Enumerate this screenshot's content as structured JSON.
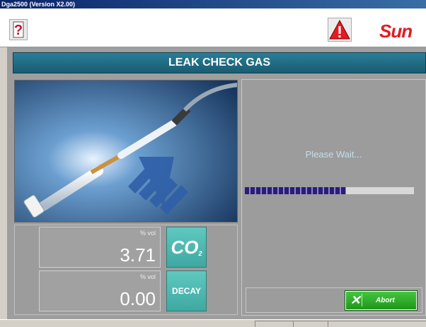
{
  "window": {
    "title": "Dga2500 (Version X2.00)"
  },
  "toolbar": {
    "help_icon": "help-question-icon",
    "warning_icon": "warning-triangle-icon",
    "brand_text": "Sun"
  },
  "screen": {
    "title": "LEAK CHECK GAS"
  },
  "status": {
    "message": "Please Wait...",
    "progress": 0.6
  },
  "readouts": [
    {
      "unit": "% vol",
      "value": "3.71",
      "gas": "CO",
      "gas_sub": "2"
    },
    {
      "unit": "% vol",
      "value": "0.00",
      "gas": "DECAY"
    }
  ],
  "buttons": {
    "abort_label": "Abort",
    "abort_icon": "close-x-icon"
  },
  "colors": {
    "header": "#1f6c85",
    "gas_badge": "#4fb8b0",
    "progress": "#2a1d78",
    "abort": "#2fae2a",
    "brand": "#e31b23"
  }
}
